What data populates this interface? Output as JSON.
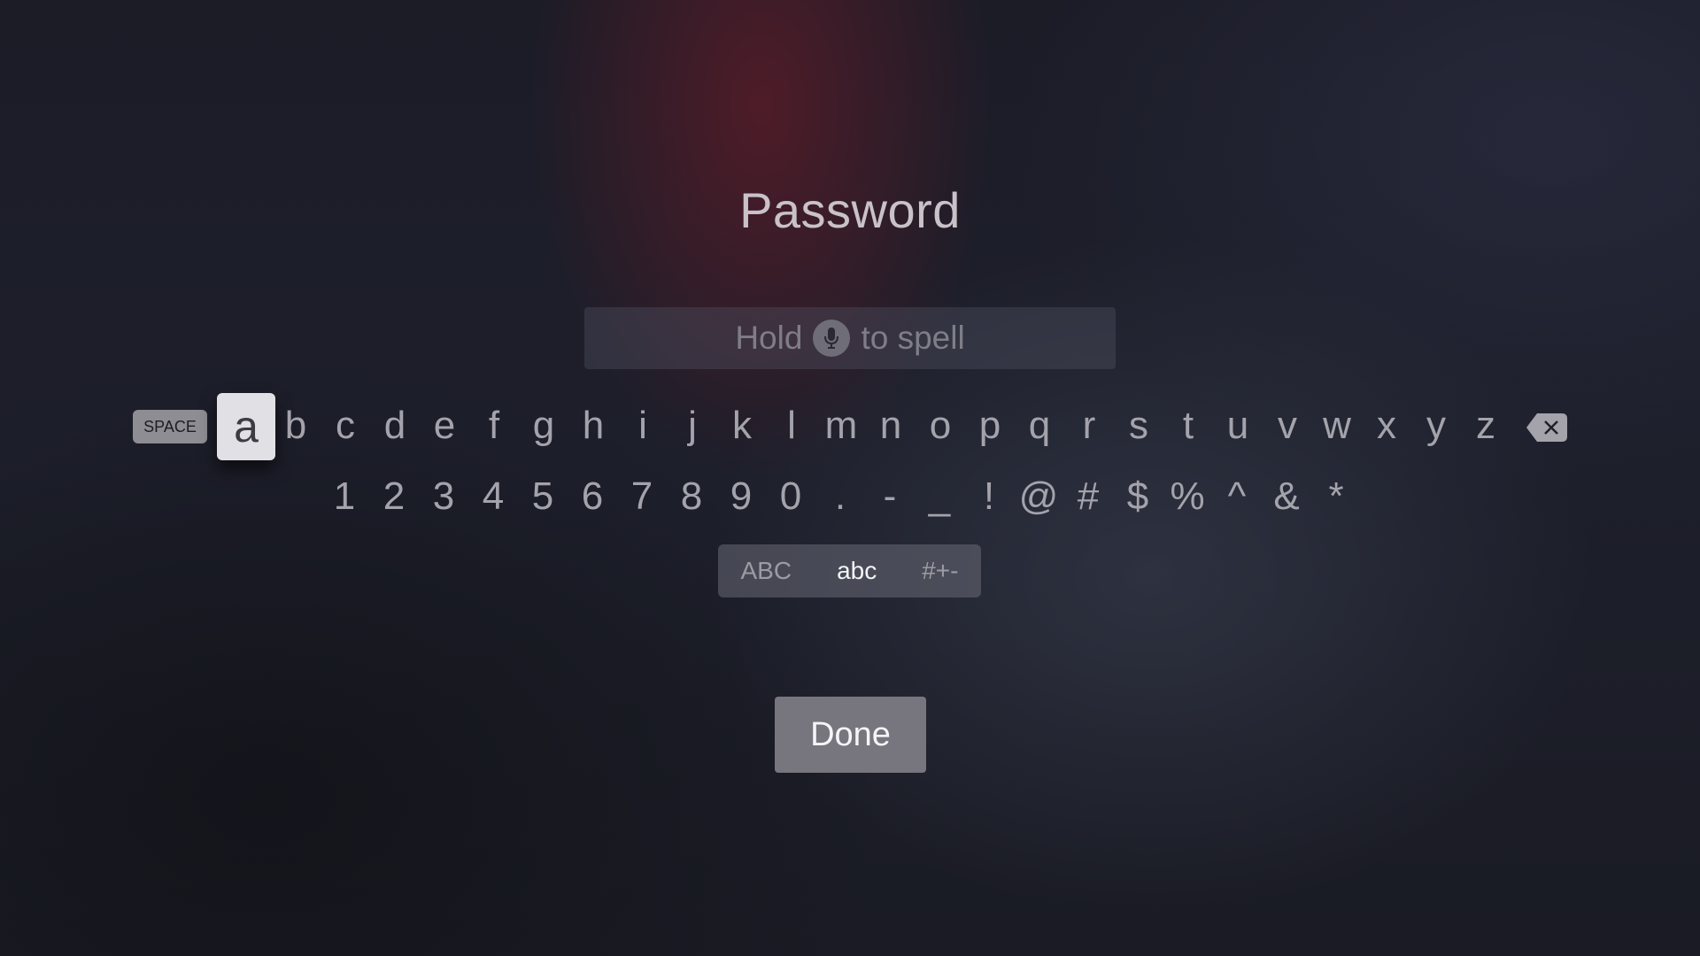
{
  "title": "Password",
  "input": {
    "hint_before": "Hold",
    "hint_icon": "microphone-icon",
    "hint_after": "to spell"
  },
  "keyboard": {
    "space_label": "SPACE",
    "focused_key": "a",
    "letters": [
      "b",
      "c",
      "d",
      "e",
      "f",
      "g",
      "h",
      "i",
      "j",
      "k",
      "l",
      "m",
      "n",
      "o",
      "p",
      "q",
      "r",
      "s",
      "t",
      "u",
      "v",
      "w",
      "x",
      "y",
      "z"
    ],
    "symbols": [
      "1",
      "2",
      "3",
      "4",
      "5",
      "6",
      "7",
      "8",
      "9",
      "0",
      ".",
      "-",
      "_",
      "!",
      "@",
      "#",
      "$",
      "%",
      "^",
      "&",
      "*"
    ],
    "delete_icon": "backspace-icon"
  },
  "modes": [
    {
      "label": "ABC",
      "active": false
    },
    {
      "label": "abc",
      "active": true
    },
    {
      "label": "#+-",
      "active": false
    }
  ],
  "done_label": "Done",
  "colors": {
    "focus_key_bg": "#e1e0e4",
    "key_text": "#a4a3ab",
    "done_bg": "#77767f"
  }
}
